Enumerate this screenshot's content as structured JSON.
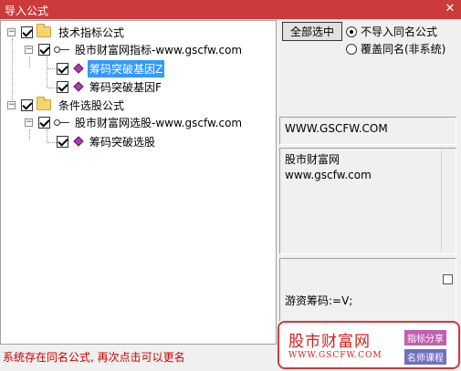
{
  "window": {
    "title": "导入公式",
    "close_glyph": "✕"
  },
  "tree": {
    "nodes": [
      {
        "label": "技术指标公式",
        "icon": "folder-icon",
        "level": 0,
        "expanded": true,
        "checked": true
      },
      {
        "label": "股市财富网指标-www.gscfw.com",
        "icon": "key-icon",
        "level": 1,
        "expanded": true,
        "checked": true
      },
      {
        "label": "筹码突破基因Z",
        "icon": "diamond-icon",
        "level": 2,
        "checked": true,
        "selected": true
      },
      {
        "label": "筹码突破基因F",
        "icon": "diamond-icon",
        "level": 2,
        "checked": true
      },
      {
        "label": "条件选股公式",
        "icon": "folder-icon",
        "level": 0,
        "expanded": true,
        "checked": true
      },
      {
        "label": "股市财富网选股-www.gscfw.com",
        "icon": "key-icon",
        "level": 1,
        "expanded": true,
        "checked": true
      },
      {
        "label": "筹码突破选股",
        "icon": "diamond-icon",
        "level": 2,
        "checked": true
      }
    ]
  },
  "options": {
    "select_all_label": "全部选中",
    "radio_skip": "不导入同名公式",
    "radio_overwrite": "覆盖同名(非系统)",
    "selected_radio": "skip"
  },
  "info": {
    "site_box": "WWW.GSCFW.COM",
    "desc_line1": "股市财富网",
    "desc_line2": "www.gscfw.com",
    "formula_text": "游资筹码:=V;"
  },
  "status_text": "系统存在同名公式, 再次点击可以更名",
  "watermark": {
    "title": "股市财富网",
    "url": "WWW.GSCFW.COM",
    "tag1": "指标分享",
    "tag2": "名师课程"
  },
  "colors": {
    "titlebar": "#cc3b3b",
    "selection": "#3399ff",
    "status": "#cc0000"
  }
}
